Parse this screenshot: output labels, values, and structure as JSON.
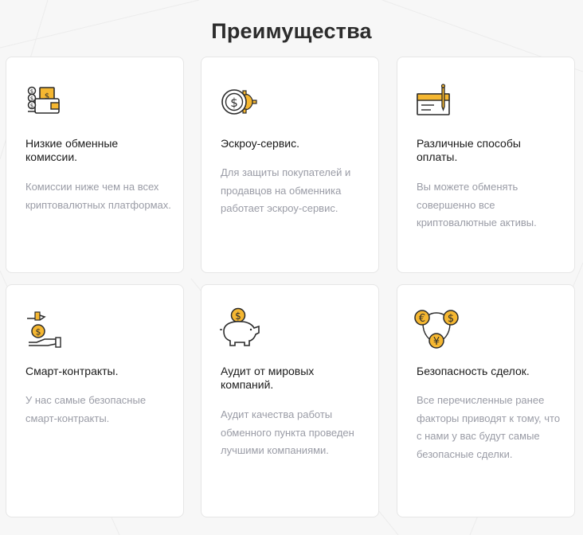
{
  "page": {
    "title": "Преимущества"
  },
  "colors": {
    "accent": "#f5b731",
    "outline": "#2b2b2b",
    "desc_text": "#9a9ca6",
    "title_text": "#1a1a1a"
  },
  "features": [
    {
      "icon": "wallet-coins-icon",
      "title": "Низкие обменные комиссии.",
      "description": "Комиссии ниже чем на всех криптовалютных платформах."
    },
    {
      "icon": "dollar-coin-gear-icon",
      "title": "Эскроу-сервис.",
      "description": "Для защиты покупателей и продавцов на обменника работает эскроу-сервис."
    },
    {
      "icon": "check-pen-icon",
      "title": "Различные способы оплаты.",
      "description": "Вы можете обменять совершенно все криптовалютные активы."
    },
    {
      "icon": "hand-coins-icon",
      "title": "Смарт-контракты.",
      "description": "У нас самые безопасные смарт-контракты."
    },
    {
      "icon": "piggy-bank-icon",
      "title": "Аудит от мировых компаний.",
      "description": "Аудит качества работы обменного пункта проведен лучшими компаниями."
    },
    {
      "icon": "currency-exchange-icon",
      "title": "Безопасность сделок.",
      "description": "Все перечисленные ранее факторы приводят к тому, что с нами у вас будут самые безопасные сделки."
    }
  ]
}
